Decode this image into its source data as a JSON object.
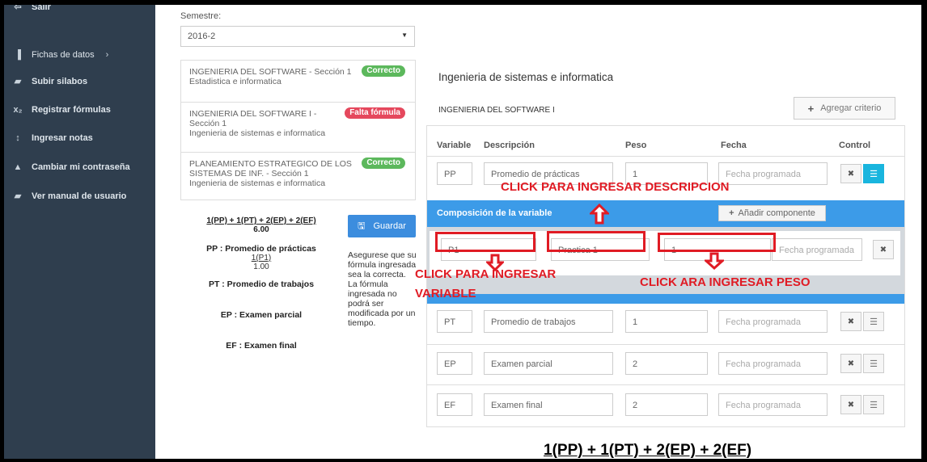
{
  "sidebar": {
    "items": [
      {
        "label": "Salir",
        "icon": "logout-icon",
        "glyph": "⇦"
      },
      {
        "label": "Fichas de datos",
        "icon": "bar-chart-icon",
        "glyph": "▐"
      },
      {
        "label": "Subir silabos",
        "icon": "book-icon",
        "glyph": "▰"
      },
      {
        "label": "Registrar fórmulas",
        "icon": "subscript-icon",
        "glyph": "x₂"
      },
      {
        "label": "Ingresar notas",
        "icon": "sort-numeric-icon",
        "glyph": "↕"
      },
      {
        "label": "Cambiar mi contraseña",
        "icon": "lock-icon",
        "glyph": "▲"
      },
      {
        "label": "Ver manual de usuario",
        "icon": "book-icon",
        "glyph": "▰"
      }
    ],
    "chevron": "›"
  },
  "semester": {
    "label": "Semestre:",
    "value": "2016-2",
    "arrow": "▼"
  },
  "courses": [
    {
      "title": "INGENIERIA DEL SOFTWARE - Sección 1",
      "subtitle": "Estadistica e informatica",
      "badge": "Correcto",
      "status": "ok"
    },
    {
      "title": "INGENIERIA DEL SOFTWARE I -",
      "title2": "Sección 1",
      "subtitle": "Ingenieria de sistemas e informatica",
      "badge": "Falta fórmula",
      "status": "bad"
    },
    {
      "title": "PLANEAMIENTO ESTRATEGICO DE LOS",
      "title2": "SISTEMAS DE INF. - Sección 1",
      "subtitle": "Ingenieria de sistemas e informatica",
      "badge": "Correcto",
      "status": "ok"
    }
  ],
  "formula": {
    "expression": "1(PP) + 1(PT) + 2(EP) + 2(EF)",
    "value": "6.00",
    "vars": [
      {
        "name": "PP : Promedio de prácticas",
        "sub": "1(P1)",
        "subval": "1.00"
      },
      {
        "name": "PT : Promedio de trabajos"
      },
      {
        "name": "EP : Examen parcial"
      },
      {
        "name": "EF : Examen final"
      }
    ]
  },
  "save_button": {
    "label": "Guardar",
    "icon": "floppy-disk-icon"
  },
  "warning": "Asegurese que su fórmula ingresada sea la correcta. La fórmula ingresada no podrá ser modificada por un tiempo.",
  "career": "Ingenieria de sistemas e informatica",
  "course_name": "INGENIERIA DEL SOFTWARE I",
  "add_criterion": {
    "label": "Agregar criterio",
    "icon": "plus-icon"
  },
  "table": {
    "headers": [
      "Variable",
      "Descripción",
      "Peso",
      "Fecha",
      "Control"
    ],
    "date_placeholder": "Fecha programada",
    "rows": [
      {
        "variable": "PP",
        "description": "Promedio de prácticas",
        "weight": "1"
      },
      {
        "variable": "PT",
        "description": "Promedio de trabajos",
        "weight": "1"
      },
      {
        "variable": "EP",
        "description": "Examen parcial",
        "weight": "2"
      },
      {
        "variable": "EF",
        "description": "Examen final",
        "weight": "2"
      }
    ]
  },
  "composition": {
    "title": "Composición de la variable",
    "add_label": "Añadir componente",
    "component": {
      "variable": "P1",
      "description": "Practica 1",
      "weight": "1",
      "date_placeholder": "Fecha programada"
    }
  },
  "annotations": {
    "description": "CLICK PARA INGRESAR DESCRIPCION",
    "variable_1": "CLICK PARA INGRESAR",
    "variable_2": "VARIABLE",
    "weight": "CLICK ARA INGRESAR PESO",
    "color": "#e01b24"
  },
  "bottom_formula": "1(PP) + 1(PT) + 2(EP) + 2(EF)"
}
